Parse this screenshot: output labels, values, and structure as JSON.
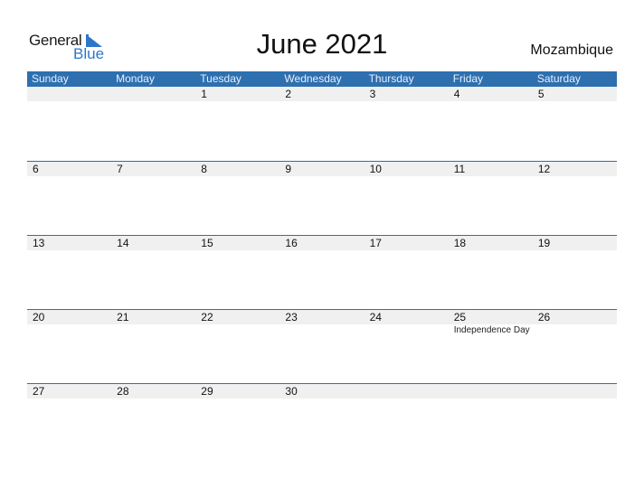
{
  "logo": {
    "general": "General",
    "blue": "Blue"
  },
  "title": "June 2021",
  "country": "Mozambique",
  "colors": {
    "accent": "#2e6fb0",
    "band": "#f0f0f0",
    "logo_blue": "#2e77c8"
  },
  "weekdays": [
    "Sunday",
    "Monday",
    "Tuesday",
    "Wednesday",
    "Thursday",
    "Friday",
    "Saturday"
  ],
  "weeks": [
    [
      {
        "day": ""
      },
      {
        "day": ""
      },
      {
        "day": "1"
      },
      {
        "day": "2"
      },
      {
        "day": "3"
      },
      {
        "day": "4"
      },
      {
        "day": "5"
      }
    ],
    [
      {
        "day": "6"
      },
      {
        "day": "7"
      },
      {
        "day": "8"
      },
      {
        "day": "9"
      },
      {
        "day": "10"
      },
      {
        "day": "11"
      },
      {
        "day": "12"
      }
    ],
    [
      {
        "day": "13"
      },
      {
        "day": "14"
      },
      {
        "day": "15"
      },
      {
        "day": "16"
      },
      {
        "day": "17"
      },
      {
        "day": "18"
      },
      {
        "day": "19"
      }
    ],
    [
      {
        "day": "20"
      },
      {
        "day": "21"
      },
      {
        "day": "22"
      },
      {
        "day": "23"
      },
      {
        "day": "24"
      },
      {
        "day": "25",
        "event": "Independence Day"
      },
      {
        "day": "26"
      }
    ],
    [
      {
        "day": "27"
      },
      {
        "day": "28"
      },
      {
        "day": "29"
      },
      {
        "day": "30"
      },
      {
        "day": ""
      },
      {
        "day": ""
      },
      {
        "day": ""
      }
    ]
  ]
}
